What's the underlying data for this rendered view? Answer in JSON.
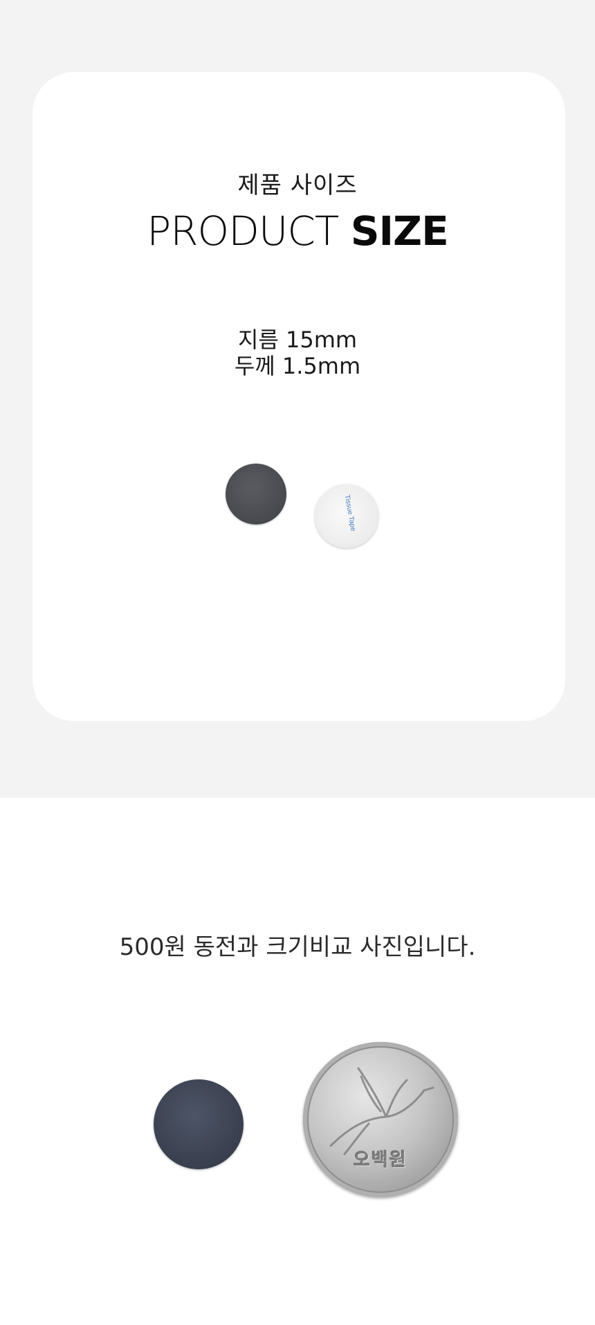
{
  "header": {
    "subtitle_ko": "제품 사이즈",
    "title_light": "PRODUCT",
    "title_bold": "SIZE"
  },
  "specs": {
    "diameter": "지름 15mm",
    "thickness": "두께 1.5mm"
  },
  "product_photo": {
    "tape_label": "Tissue Tape"
  },
  "comparison": {
    "caption": "500원 동전과 크기비교 사진입니다.",
    "coin_label": "오백원"
  },
  "colors": {
    "top_background": "#f3f3f3",
    "card_background": "#ffffff",
    "magnet_dark": "#4a4c52"
  }
}
